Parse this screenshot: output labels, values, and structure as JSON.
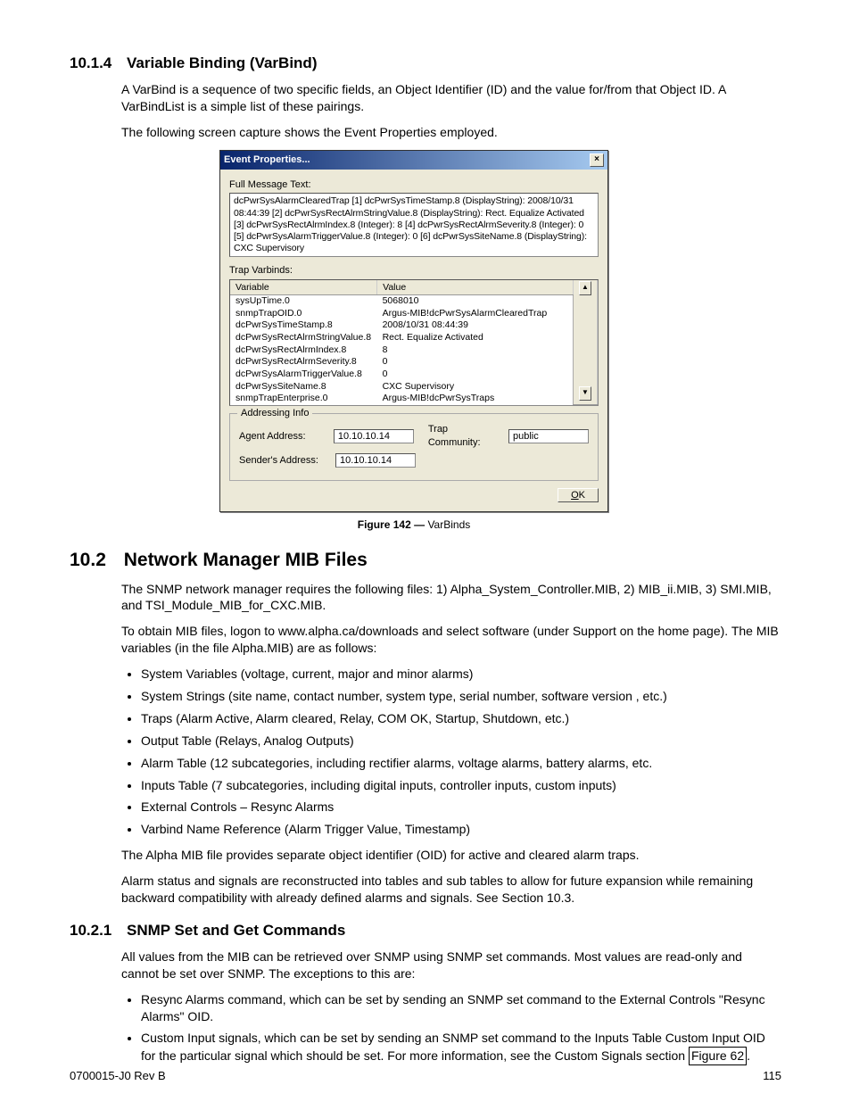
{
  "section_10_1_4": {
    "number": "10.1.4",
    "title": "Variable Binding (VarBind)",
    "para1": "A VarBind is a sequence of two specific fields, an Object Identifier (ID) and the value for/from that Object ID. A VarBindList is a simple list of these pairings.",
    "para2": "The following screen capture shows the Event Properties employed."
  },
  "dialog": {
    "title": "Event Properties...",
    "full_msg_label": "Full Message Text:",
    "full_msg_text": "dcPwrSysAlarmClearedTrap [1] dcPwrSysTimeStamp.8 (DisplayString): 2008/10/31 08:44:39 [2] dcPwrSysRectAlrmStringValue.8 (DisplayString): Rect. Equalize Activated [3] dcPwrSysRectAlrmIndex.8 (Integer): 8 [4] dcPwrSysRectAlrmSeverity.8 (Integer): 0 [5] dcPwrSysAlarmTriggerValue.8 (Integer): 0 [6] dcPwrSysSiteName.8 (DisplayString): CXC Supervisory",
    "trap_varbinds_label": "Trap Varbinds:",
    "col_variable": "Variable",
    "col_value": "Value",
    "rows": [
      {
        "v": "sysUpTime.0",
        "val": "5068010"
      },
      {
        "v": "snmpTrapOID.0",
        "val": "Argus-MIB!dcPwrSysAlarmClearedTrap"
      },
      {
        "v": "dcPwrSysTimeStamp.8",
        "val": "2008/10/31 08:44:39"
      },
      {
        "v": "dcPwrSysRectAlrmStringValue.8",
        "val": "Rect. Equalize Activated"
      },
      {
        "v": "dcPwrSysRectAlrmIndex.8",
        "val": "8"
      },
      {
        "v": "dcPwrSysRectAlrmSeverity.8",
        "val": "0"
      },
      {
        "v": "dcPwrSysAlarmTriggerValue.8",
        "val": "0"
      },
      {
        "v": "dcPwrSysSiteName.8",
        "val": "CXC Supervisory"
      },
      {
        "v": "snmpTrapEnterprise.0",
        "val": "Argus-MIB!dcPwrSysTraps"
      }
    ],
    "addressing_info": "Addressing Info",
    "agent_address_label": "Agent Address:",
    "agent_address_value": "10.10.10.14",
    "sender_address_label": "Sender's Address:",
    "sender_address_value": "10.10.10.14",
    "trap_community_label": "Trap Community:",
    "trap_community_value": "public",
    "ok_u": "O",
    "ok_k": "K"
  },
  "figure": {
    "label": "Figure 142",
    "dash": " — ",
    "caption": "VarBinds"
  },
  "section_10_2": {
    "number": "10.2",
    "title": "Network Manager MIB Files",
    "para1": "The SNMP network manager requires the following files: 1) Alpha_System_Controller.MIB, 2) MIB_ii.MIB, 3) SMI.MIB, and TSI_Module_MIB_for_CXC.MIB.",
    "para2": "To obtain MIB files, logon to www.alpha.ca/downloads and select software (under Support on the home page). The MIB variables (in the file Alpha.MIB) are as follows:",
    "bullets": [
      "System Variables (voltage, current, major and minor alarms)",
      "System Strings (site name, contact number, system type, serial number, software version , etc.)",
      "Traps (Alarm Active, Alarm cleared, Relay, COM OK, Startup, Shutdown, etc.)",
      "Output Table (Relays, Analog Outputs)",
      "Alarm Table (12 subcategories, including rectifier alarms, voltage alarms, battery alarms, etc.",
      "Inputs Table (7 subcategories, including digital inputs, controller inputs, custom inputs)",
      "External Controls – Resync Alarms",
      "Varbind Name Reference (Alarm Trigger Value, Timestamp)"
    ],
    "para3": "The Alpha MIB file provides separate object identifier (OID) for active and cleared alarm traps.",
    "para4": "Alarm status and signals are reconstructed into tables and sub tables to allow for future expansion while remaining backward compatibility with already defined alarms and signals. See Section 10.3."
  },
  "section_10_2_1": {
    "number": "10.2.1",
    "title": "SNMP Set and Get Commands",
    "para1": "All values from the MIB can be retrieved over SNMP using SNMP set commands. Most values are read-only and cannot be set over SNMP. The exceptions to this are:",
    "bullet1": "Resync Alarms command, which can be set by sending an SNMP set command to the External Controls \"Resync Alarms\" OID.",
    "bullet2a": "Custom Input signals, which can be set by sending an SNMP set command to the Inputs Table Custom Input OID for the particular signal which should be set. For more information, see the Custom Signals section ",
    "bullet2_link": "Figure 62",
    "bullet2b": "."
  },
  "footer": {
    "left": "0700015-J0    Rev B",
    "right": "115"
  }
}
